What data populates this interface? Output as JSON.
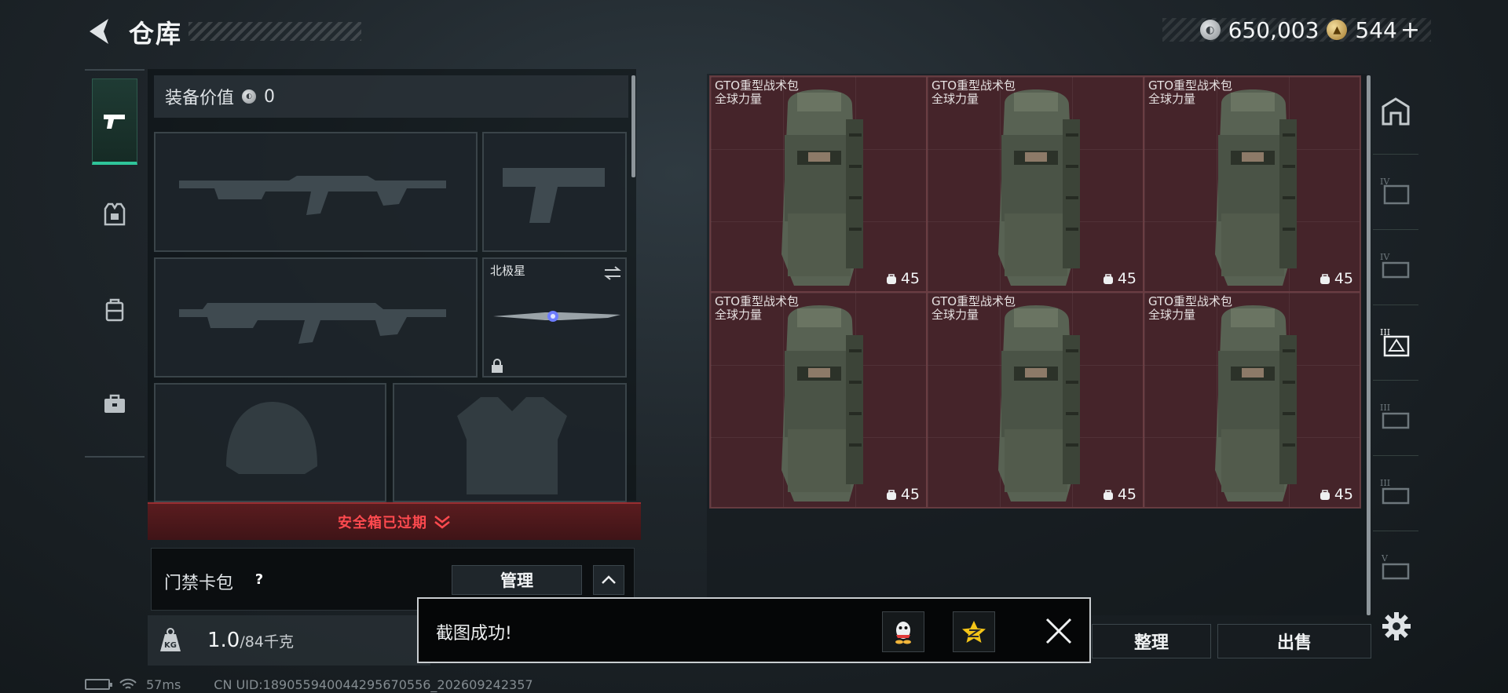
{
  "header": {
    "title": "仓库",
    "currency": [
      {
        "name": "silver-coin",
        "value": "650,003"
      },
      {
        "name": "gold-coin",
        "value": "544"
      }
    ],
    "add_label": "+"
  },
  "left_nav": {
    "items": [
      {
        "icon": "pistol-icon",
        "active": true
      },
      {
        "icon": "armor-vest-icon",
        "active": false
      },
      {
        "icon": "backpack-icon",
        "active": false
      },
      {
        "icon": "briefcase-icon",
        "active": false
      }
    ]
  },
  "equipment": {
    "value_label": "装备价值",
    "value": "0",
    "knife_name": "北极星",
    "safe_box_text": "安全箱已过期",
    "access_card_label": "门禁卡包",
    "help_label": "?",
    "manage_label": "管理",
    "weight_value": "1.0",
    "weight_capacity": "/84千克"
  },
  "storage": {
    "items": [
      {
        "name": "GTO重型战术包",
        "sub": "全球力量",
        "capacity": "45"
      },
      {
        "name": "GTO重型战术包",
        "sub": "全球力量",
        "capacity": "45"
      },
      {
        "name": "GTO重型战术包",
        "sub": "全球力量",
        "capacity": "45"
      },
      {
        "name": "GTO重型战术包",
        "sub": "全球力量",
        "capacity": "45"
      },
      {
        "name": "GTO重型战术包",
        "sub": "全球力量",
        "capacity": "45"
      },
      {
        "name": "GTO重型战术包",
        "sub": "全球力量",
        "capacity": "45"
      }
    ],
    "arrange_label": "整理",
    "sell_label": "出售"
  },
  "right_tools": {
    "items": [
      {
        "icon": "home-icon"
      },
      {
        "icon": "tier-iv-rifle-filter-icon"
      },
      {
        "icon": "tier-iv-gear-filter-icon"
      },
      {
        "icon": "tier-iii-armor-filter-icon"
      },
      {
        "icon": "tier-iii-key-filter-icon"
      },
      {
        "icon": "tier-iii-key-filter-icon"
      },
      {
        "icon": "tier-v-key-filter-icon"
      }
    ]
  },
  "toast": {
    "text": "截图成功!",
    "share_targets": [
      "qq-icon",
      "qzone-icon"
    ]
  },
  "status": {
    "ping": "57ms",
    "uid": "CN UID:18905594004429567055​6_202609242357"
  },
  "colors": {
    "accent_green": "#2fc59a",
    "alert_red": "#ff4a4f",
    "cell_bg": "#45242a"
  }
}
